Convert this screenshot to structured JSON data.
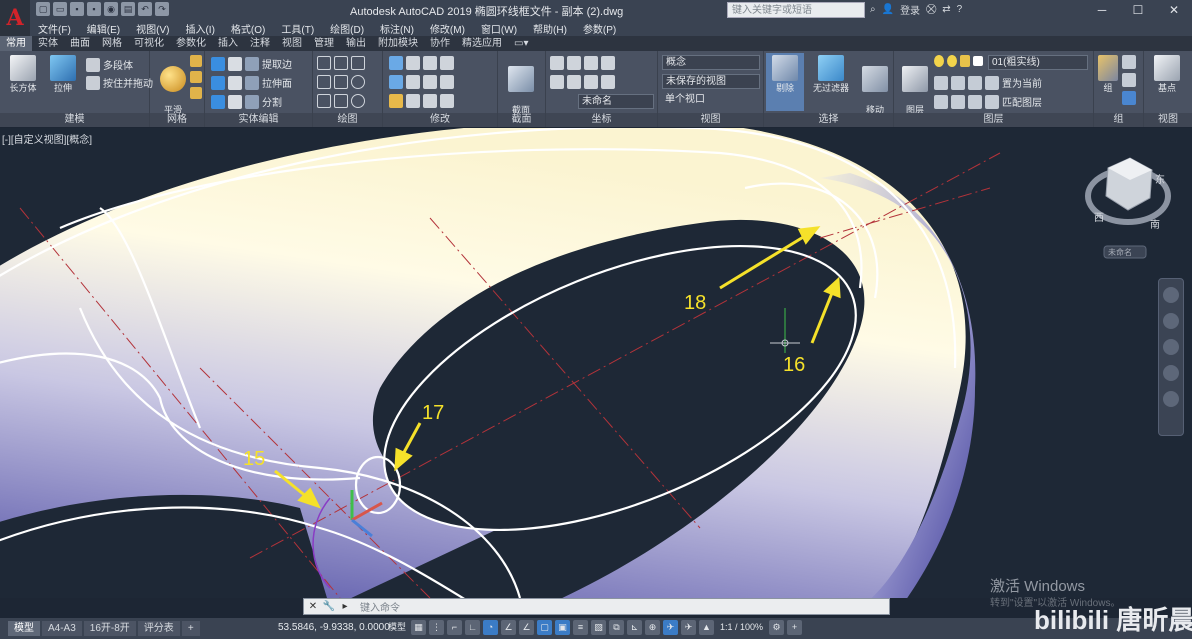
{
  "app": {
    "logo": "A",
    "title": "Autodesk AutoCAD 2019    椭圆环线框文件 - 副本 (2).dwg",
    "search_placeholder": "键入关键字或短语",
    "login": "登录"
  },
  "menus": [
    "文件(F)",
    "编辑(E)",
    "视图(V)",
    "插入(I)",
    "格式(O)",
    "工具(T)",
    "绘图(D)",
    "标注(N)",
    "修改(M)",
    "窗口(W)",
    "帮助(H)",
    "参数(P)"
  ],
  "ribbon_tabs": [
    "常用",
    "实体",
    "曲面",
    "网格",
    "可视化",
    "参数化",
    "插入",
    "注释",
    "视图",
    "管理",
    "输出",
    "附加模块",
    "协作",
    "精选应用"
  ],
  "active_tab": "常用",
  "ribbon": {
    "modeling": {
      "title": "建模",
      "box": "长方体",
      "extrude": "拉伸",
      "polysolid": "多段体",
      "presspull": "按住并拖动"
    },
    "mesh": {
      "title": "网格",
      "smooth": "平滑\n对象"
    },
    "solid_edit": {
      "title": "实体编辑",
      "extract_edges": "提取边",
      "extrude_faces": "拉伸面",
      "separate": "分割"
    },
    "draw": {
      "title": "绘图"
    },
    "modify": {
      "title": "修改"
    },
    "section": {
      "title": "截面",
      "section_plane": "截面\n平面"
    },
    "coords": {
      "title": "坐标",
      "ucs_name": "未命名"
    },
    "view": {
      "title": "视图",
      "visual_style": "概念",
      "saved_view": "未保存的视图",
      "viewport": "单个视口"
    },
    "selection": {
      "title": "选择",
      "cull": "剔除",
      "no_filter": "无过滤器",
      "gizmo": "移动\n小控件"
    },
    "layers": {
      "title": "图层",
      "layer_props": "图层\n特性",
      "current_layer": "01(粗实线)",
      "set_current": "置为当前",
      "match_layer": "匹配图层"
    },
    "groups": {
      "title": "组",
      "group": "组"
    },
    "view2": {
      "title": "视图",
      "base": "基点"
    }
  },
  "viewport": {
    "label": "[-][自定义视图][概念]",
    "viewcube_w": "西",
    "viewcube_s": "南",
    "viewcube_n": "东",
    "wcs": "未命名",
    "annotations": [
      "15",
      "16",
      "17",
      "18"
    ]
  },
  "command": {
    "placeholder": "键入命令"
  },
  "status": {
    "layout_tabs": [
      "模型",
      "A4-A3",
      "16开-8开",
      "评分表"
    ],
    "coords": "53.5846, -9.9338, 0.0000",
    "model": "模型",
    "scale": "1:1 / 100%"
  },
  "watermark": {
    "line1": "激活 Windows",
    "line2": "转到\"设置\"以激活 Windows。",
    "brand": "bilibili 唐昕晨"
  },
  "colors": {
    "accent_blue": "#3b7cc6",
    "torus_light": "#fffbe6",
    "torus_dark": "#4c4aa3",
    "annotation": "#f5e12a",
    "background": "#1e2836"
  }
}
